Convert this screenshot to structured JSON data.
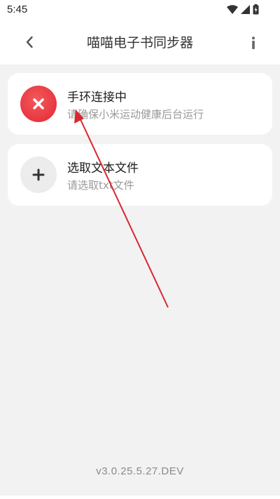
{
  "status_bar": {
    "time": "5:45",
    "icons": [
      "wifi-icon",
      "signal-icon",
      "battery-icon"
    ]
  },
  "app_bar": {
    "title": "喵喵电子书同步器",
    "back_icon": "chevron-left-icon",
    "info_icon": "info-icon"
  },
  "cards": [
    {
      "title": "手环连接中",
      "subtitle": "请确保小米运动健康后台运行",
      "icon": "close-icon",
      "accent": "#e8363f"
    },
    {
      "title": "选取文本文件",
      "subtitle": "请选取txt文件",
      "icon": "plus-icon",
      "accent": "#ececed"
    }
  ],
  "version": "v3.0.25.5.27.DEV",
  "annotation": {
    "arrow_color": "#d9262f"
  }
}
